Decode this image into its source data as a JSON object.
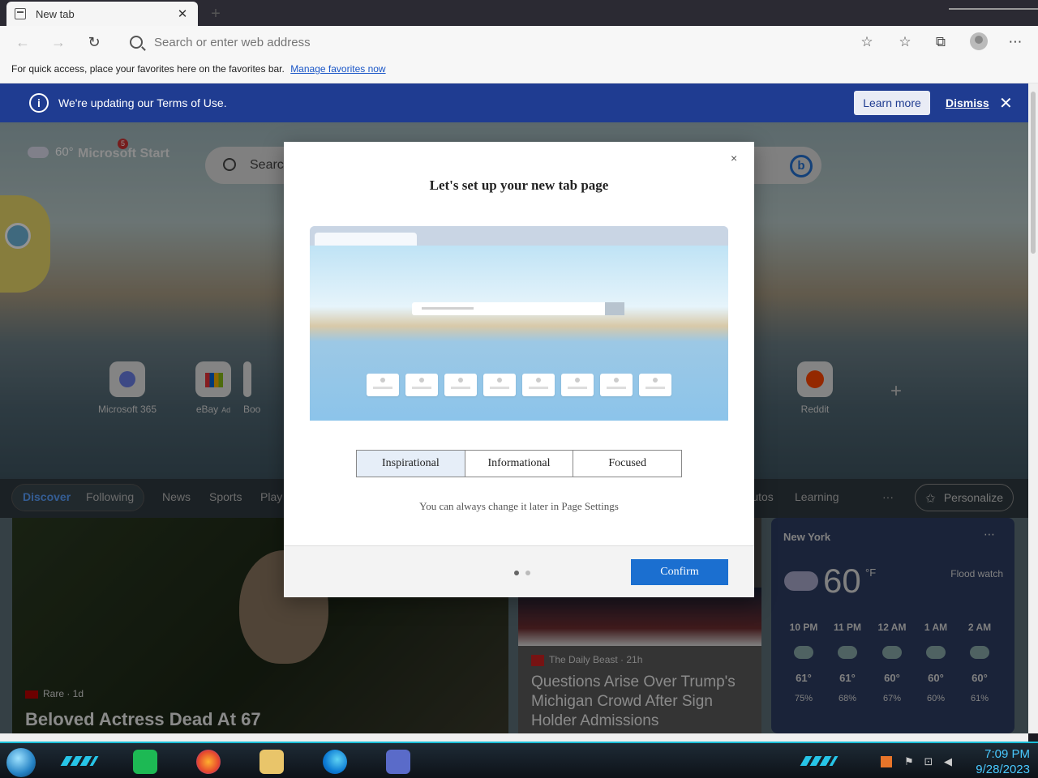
{
  "browser": {
    "tab_title": "New tab",
    "address_placeholder": "Search or enter web address",
    "favorites_bar_text": "For quick access, place your favorites here on the favorites bar.",
    "favorites_bar_link": "Manage favorites now"
  },
  "banner": {
    "message": "We're updating our Terms of Use.",
    "learn_more": "Learn more",
    "dismiss": "Dismiss"
  },
  "ntp": {
    "weather_temp": "60°",
    "brand": "Microsoft Start",
    "notification_count": "5",
    "search_placeholder": "Search",
    "bing_label": "b",
    "quick_links": [
      {
        "label": "Microsoft 365"
      },
      {
        "label": "eBay",
        "ad": "Ad"
      },
      {
        "label": "Boo"
      },
      {
        "label": "Reddit"
      }
    ],
    "feed_nav": [
      "Discover",
      "Following",
      "News",
      "Sports",
      "Play",
      "Autos",
      "Learning"
    ],
    "more_label": "···",
    "personalize": "Personalize",
    "card1": {
      "source": "Rare · 1d",
      "title": "Beloved Actress Dead At 67"
    },
    "card2": {
      "source": "The Daily Beast · 21h",
      "title": "Questions Arise Over Trump's Michigan Crowd After Sign Holder Admissions"
    },
    "weather_card": {
      "city": "New York",
      "temp": "60",
      "unit": "°F",
      "alert": "Flood watch",
      "hours": [
        {
          "time": "10 PM",
          "temp": "61°",
          "precip": "75%"
        },
        {
          "time": "11 PM",
          "temp": "61°",
          "precip": "68%"
        },
        {
          "time": "12 AM",
          "temp": "60°",
          "precip": "67%"
        },
        {
          "time": "1 AM",
          "temp": "60°",
          "precip": "60%"
        },
        {
          "time": "2 AM",
          "temp": "60°",
          "precip": "61%"
        }
      ]
    }
  },
  "modal": {
    "title": "Let's set up your new tab page",
    "close": "×",
    "options": [
      "Inspirational",
      "Informational",
      "Focused"
    ],
    "selected_option": "Inspirational",
    "hint": "You can always change it later in Page Settings",
    "confirm": "Confirm",
    "page_indicator": {
      "current": 1,
      "total": 2
    }
  },
  "taskbar": {
    "time": "7:09 PM",
    "date": "9/28/2023"
  },
  "colors": {
    "banner_bg": "#1f3c91",
    "accent": "#1b6fd0",
    "taskbar_accent": "#1bbfd9"
  }
}
